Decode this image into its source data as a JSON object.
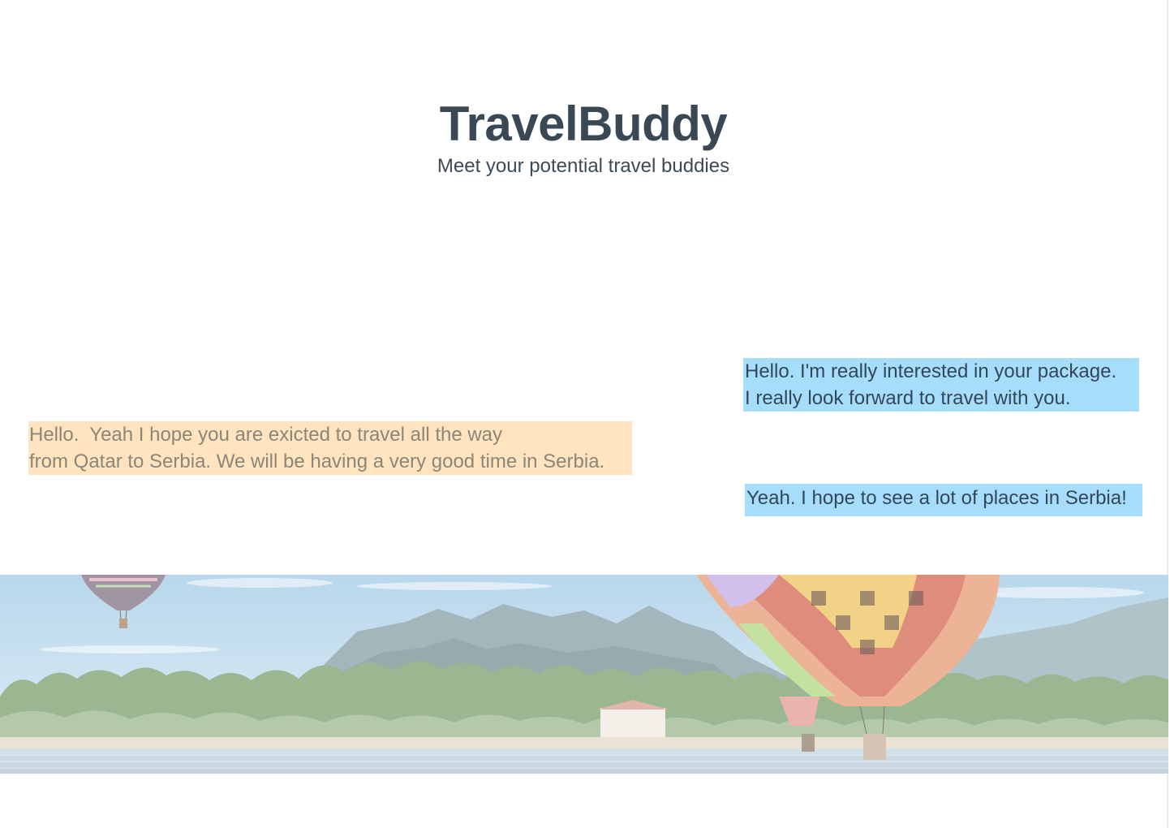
{
  "header": {
    "title": "TravelBuddy",
    "subtitle": "Meet your potential travel buddies"
  },
  "messages": [
    {
      "direction": "sent",
      "text": "Hello. I'm really interested in your package.\nI really look forward to travel with you."
    },
    {
      "direction": "received",
      "text": "Hello.  Yeah I hope you are exicted to travel all the way\nfrom Qatar to Serbia. We will be having a very good time in Serbia."
    },
    {
      "direction": "sent",
      "text": "Yeah. I hope to see a lot of places in Serbia!"
    }
  ],
  "colors": {
    "sent_bubble": "#a6ddfb",
    "received_bubble": "#ffe4bf",
    "title_text": "#3a4754"
  },
  "banner": {
    "image": "hot-air-balloons-over-lake-with-mountains"
  }
}
